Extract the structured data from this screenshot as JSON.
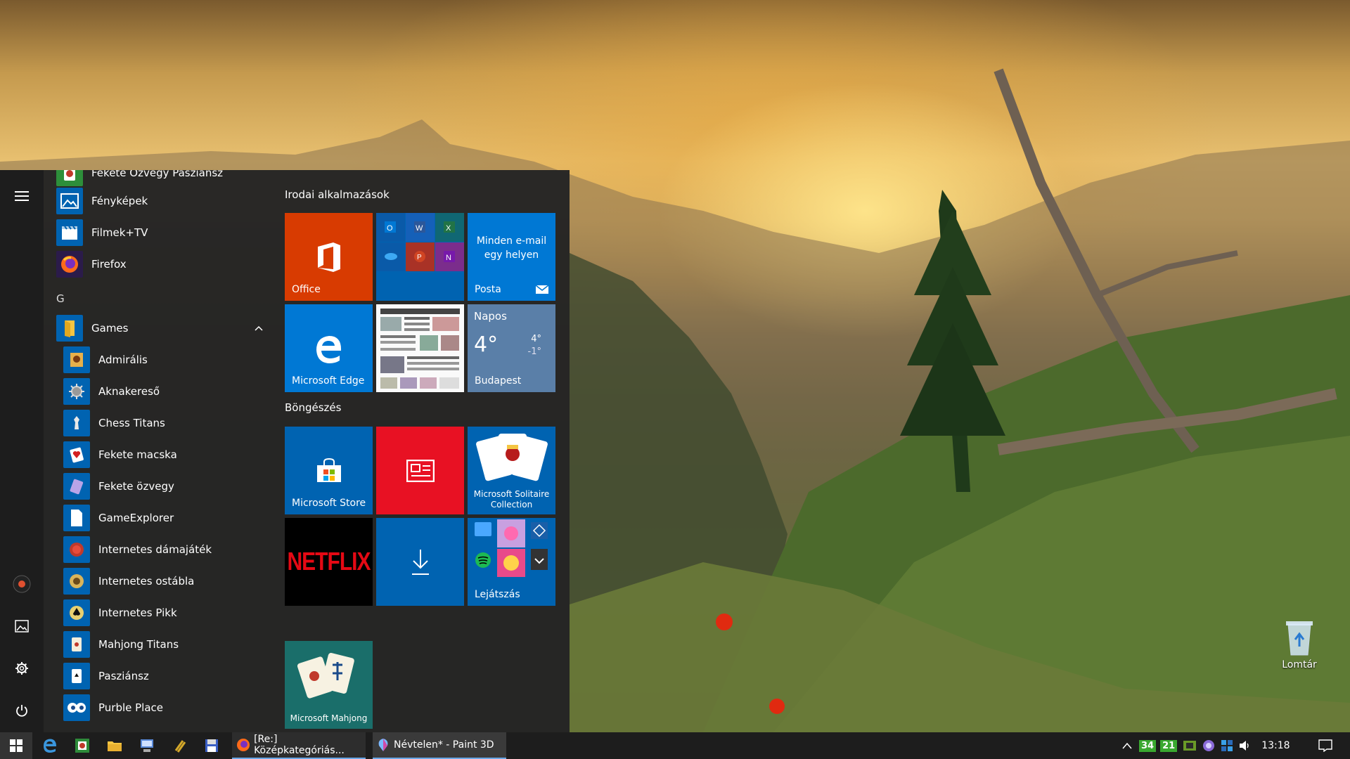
{
  "start_menu": {
    "apps": [
      {
        "label": "Fekete Özvegy Pasziánsz",
        "icon": "spider-solitaire-icon"
      },
      {
        "label": "Fényképek",
        "icon": "photos-icon"
      },
      {
        "label": "Filmek+TV",
        "icon": "movies-tv-icon"
      },
      {
        "label": "Firefox",
        "icon": "firefox-icon"
      }
    ],
    "group_letter": "G",
    "games_folder": {
      "label": "Games",
      "items": [
        {
          "label": "Admirális"
        },
        {
          "label": "Aknakereső"
        },
        {
          "label": "Chess Titans"
        },
        {
          "label": "Fekete macska"
        },
        {
          "label": "Fekete özvegy"
        },
        {
          "label": "GameExplorer"
        },
        {
          "label": "Internetes dámajáték"
        },
        {
          "label": "Internetes ostábla"
        },
        {
          "label": "Internetes Pikk"
        },
        {
          "label": "Mahjong Titans"
        },
        {
          "label": "Pasziánsz"
        },
        {
          "label": "Purble Place"
        }
      ]
    },
    "tile_groups": [
      {
        "title": "Irodai alkalmazások"
      },
      {
        "title": "Böngészés"
      }
    ],
    "tiles": {
      "office": "Office",
      "mail_text": "Minden e-mail egy helyen",
      "mail_label": "Posta",
      "edge": "Microsoft Edge",
      "weather_title": "Napos",
      "weather_temp": "4°",
      "weather_high": "4°",
      "weather_low": "-1°",
      "weather_city": "Budapest",
      "store": "Microsoft Store",
      "solitaire": "Microsoft Solitaire Collection",
      "netflix": "NETFLIX",
      "play": "Lejátszás",
      "mahjong": "Microsoft Mahjong"
    }
  },
  "desktop": {
    "recycle_bin": "Lomtár"
  },
  "taskbar": {
    "apps": [
      {
        "label": "[Re:] Középkategóriás..."
      },
      {
        "label": "Névtelen* - Paint 3D"
      }
    ],
    "tray_badge_1": "34",
    "tray_badge_2": "21",
    "clock": "13:18"
  },
  "colors": {
    "office_tile": "#d83b01",
    "accent_blue": "#0063b1",
    "news_red": "#e81123",
    "netflix_red": "#e50914"
  }
}
